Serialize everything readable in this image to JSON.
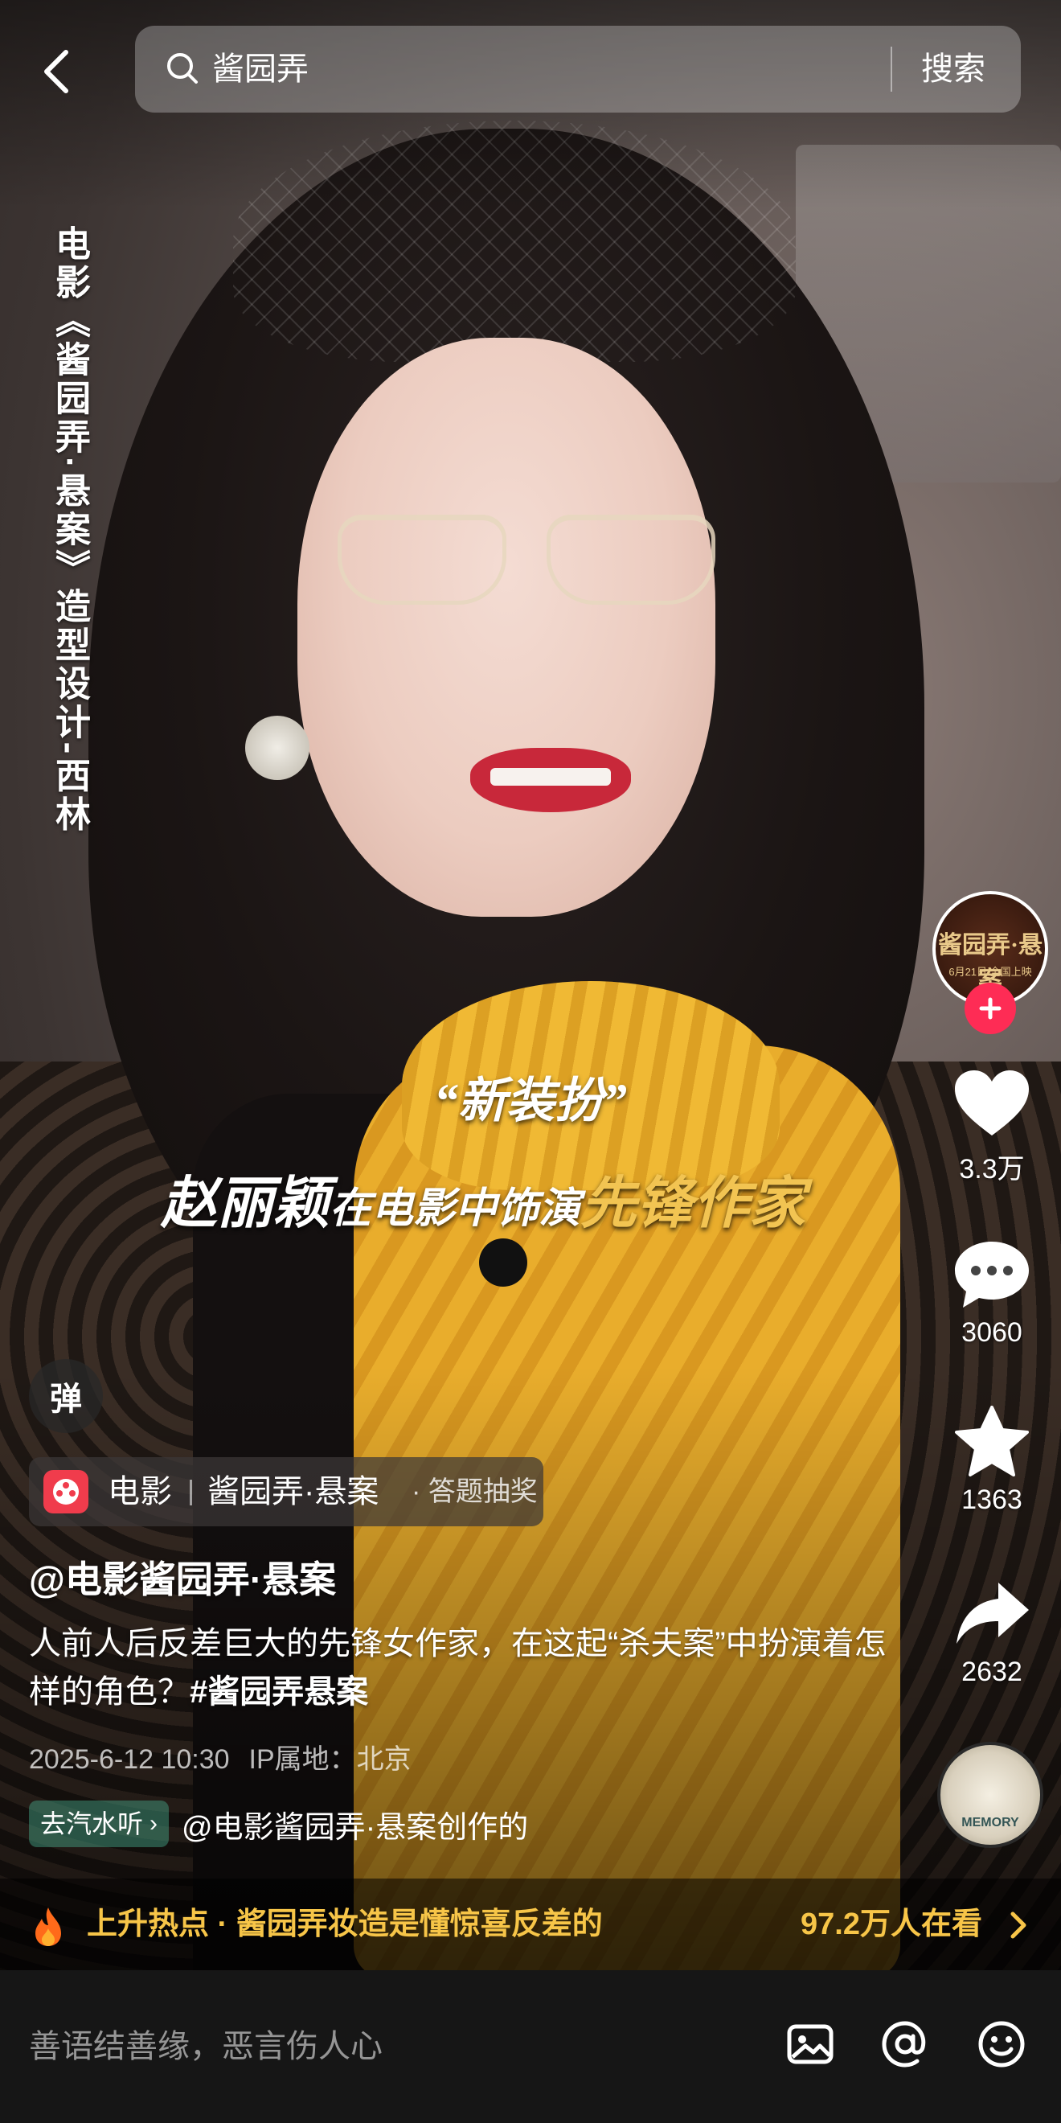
{
  "search": {
    "query": "酱园弄",
    "button_label": "搜索"
  },
  "video": {
    "vertical_title": "电影《酱园弄·悬案》造型设计-西林",
    "subtitle_line1": "“新装扮”",
    "subtitle_line2": {
      "name": "赵丽颖",
      "middle": "在电影中饰演",
      "role": "先锋作家"
    }
  },
  "creator_avatar": {
    "logo_text": "酱园弄·悬案",
    "logo_sub": "6月21日 全国上映"
  },
  "rail": {
    "likes": "3.3万",
    "comments": "3060",
    "favorites": "1363",
    "shares": "2632",
    "music_disc_text": "MEMORY"
  },
  "danmaku_label": "弹",
  "movie_tag": {
    "category": "电影",
    "name": "酱园弄·悬案",
    "action": "· 答题抽奖"
  },
  "author": "@电影酱园弄·悬案",
  "description": {
    "text": "人前人后反差巨大的先锋女作家，在这起“杀夫案”中扮演着怎样的角色？",
    "hashtag": "#酱园弄悬案"
  },
  "meta": {
    "datetime": "2025-6-12 10:30",
    "ip_location": "IP属地：北京"
  },
  "music": {
    "tag_label": "去汽水听",
    "credit": "@电影酱园弄·悬案创作的"
  },
  "hot": {
    "text": "上升热点 · 酱园弄妆造是懂惊喜反差的",
    "viewers": "97.2万人在看"
  },
  "comment": {
    "placeholder": "善语结善缘，恶言伤人心"
  },
  "colors": {
    "accent_red": "#fe2c55",
    "hot_gold": "#f7c548",
    "subtitle_gold": "#f2c452"
  },
  "icons": [
    "back-arrow-icon",
    "search-icon",
    "plus-icon",
    "heart-icon",
    "comment-icon",
    "star-icon",
    "share-icon",
    "fire-icon",
    "chevron-right-icon",
    "image-icon",
    "at-icon",
    "emoji-icon"
  ]
}
